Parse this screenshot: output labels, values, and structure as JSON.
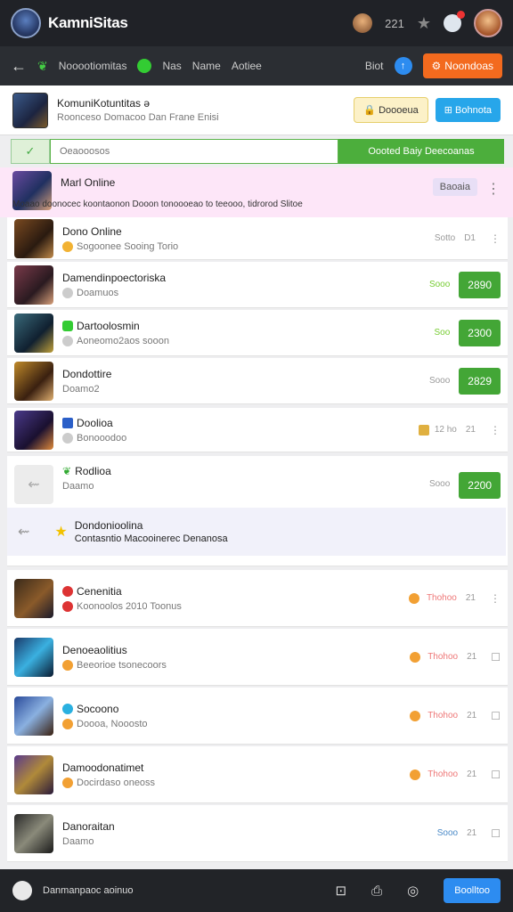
{
  "header": {
    "app_title": "KamniSitas",
    "count": "221"
  },
  "nav": {
    "items": [
      "Nooootiomitas",
      "Nas",
      "Name",
      "Aotiee"
    ],
    "right_label": "Biot",
    "orange_label": "Noondoas"
  },
  "card": {
    "title": "KomuniKotuntitas ə",
    "subtitle": "Roonceso Domacoo Dan Frane Enisi",
    "btn1": "Doooeua",
    "btn2": "Bohnota"
  },
  "search": {
    "placeholder": "Oeaooosos",
    "button": "Oooted Baiy Deecoanas"
  },
  "pinned": {
    "title": "Marl Online",
    "subtitle": "Moaao doonocec koontaonon Dooon tonoooeao to teeooo, tidrorod Slitoe",
    "tag": "Baoaia"
  },
  "rows": [
    {
      "title": "Dono Online",
      "sub": "Sogoonee Sooing Torio",
      "meta": "Sotto",
      "right": "D1"
    },
    {
      "title": "Damendinpoectoriska",
      "sub": "Doamuos",
      "meta": "Sooo",
      "badge": "2890"
    },
    {
      "title": "Dartoolosmin",
      "sub": "Aoneomo2aos sooon",
      "meta": "Soo",
      "badge": "2300"
    },
    {
      "title": "Dondottire",
      "sub": "Doamo2",
      "meta": "Sooo",
      "badge": "2829"
    },
    {
      "title": "Doolioa",
      "sub": "Bonooodoo",
      "meta": "12 ho",
      "right": "21"
    },
    {
      "title": "Rodlioa",
      "sub": "Daamo",
      "meta": "Sooo",
      "badge": "2200"
    }
  ],
  "inner": {
    "title": "Dondonioolina",
    "sub": "Contasntio Macooinerec Denanosa"
  },
  "lower_rows": [
    {
      "title": "Cenenitia",
      "sub": "Koonoolos 2010 Toonus",
      "meta": "Thohoo",
      "right": "21"
    },
    {
      "title": "Denoeaolitius",
      "sub": "Beeorioe tsonecoors",
      "meta": "Thohoo",
      "right": "21"
    },
    {
      "title": "Socoono",
      "sub": "Doooa, Nooosto",
      "meta": "Thohoo",
      "right": "21"
    },
    {
      "title": "Damoodonatimet",
      "sub": "Docirdaso oneoss",
      "meta": "Thohoo",
      "right": "21"
    },
    {
      "title": "Danoraitan",
      "sub": "Daamo",
      "meta": "Sooo",
      "right": "21"
    }
  ],
  "bottom": {
    "left_label": "Danmanpaoc aoinuo",
    "btn": "Boolltoo"
  }
}
